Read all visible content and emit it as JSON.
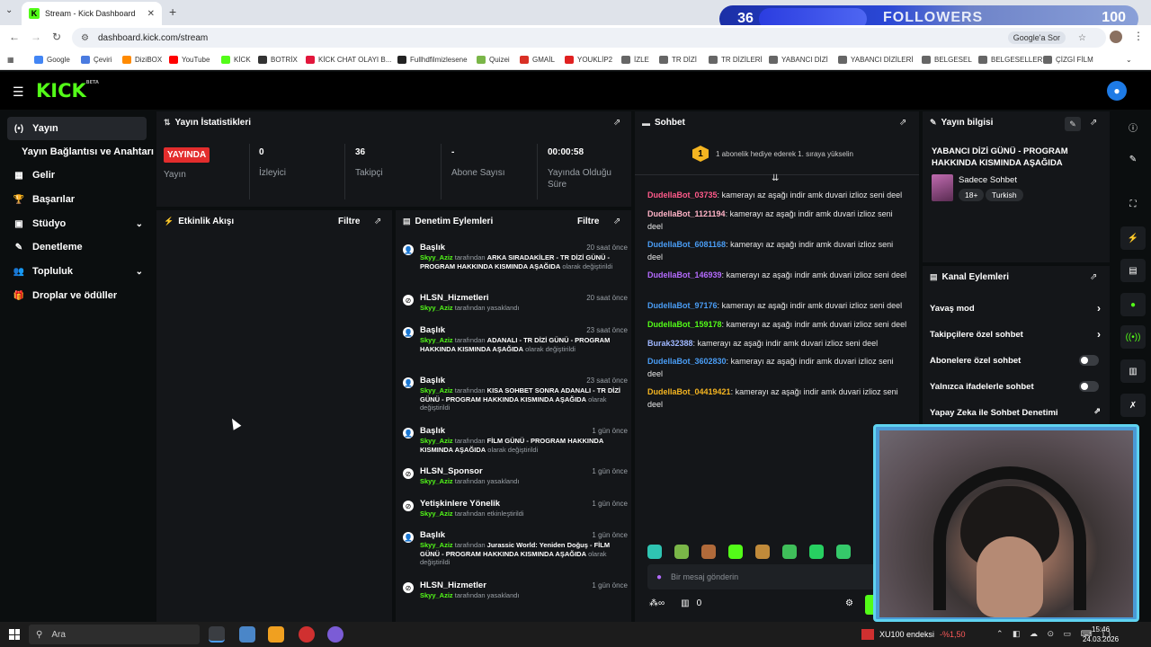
{
  "browser": {
    "tab_title": "Stream - Kick Dashboard",
    "url": "dashboard.kick.com/stream",
    "google_btn": "Google'a Sor",
    "bookmarks": [
      {
        "label": "Google",
        "color": "#4285f4"
      },
      {
        "label": "Çeviri",
        "color": "#4a7be0"
      },
      {
        "label": "DiziBOX",
        "color": "#ff8a00"
      },
      {
        "label": "YouTube",
        "color": "#ff0000"
      },
      {
        "label": "KİCK",
        "color": "#53fc18"
      },
      {
        "label": "BOTRİX",
        "color": "#333333"
      },
      {
        "label": "KİCK CHAT OLAYI B...",
        "color": "#e2163b"
      },
      {
        "label": "Fullhdfilmizlesene",
        "color": "#222222"
      },
      {
        "label": "Quizei",
        "color": "#7ab648"
      },
      {
        "label": "GMAİL",
        "color": "#d93025"
      },
      {
        "label": "YOUKLİP2",
        "color": "#e02020"
      },
      {
        "label": "İZLE",
        "color": "#666666"
      },
      {
        "label": "TR DİZİ",
        "color": "#666666"
      },
      {
        "label": "TR DİZİLERİ",
        "color": "#666666"
      },
      {
        "label": "YABANCI DİZİ",
        "color": "#666666"
      },
      {
        "label": "YABANCI DİZİLERİ",
        "color": "#666666"
      },
      {
        "label": "BELGESEL",
        "color": "#666666"
      },
      {
        "label": "BELGESELLER",
        "color": "#666666"
      },
      {
        "label": "ÇİZGİ FİLM",
        "color": "#666666"
      }
    ]
  },
  "overlay": {
    "left_count": "36",
    "label": "FOLLOWERS",
    "right_count": "100"
  },
  "kick": {
    "logo": "KICK",
    "beta": "BETA"
  },
  "sidebar": {
    "items": [
      {
        "label": "Yayın",
        "icon": "(•)"
      },
      {
        "label": "Yayın Bağlantısı ve Anahtarı",
        "icon": ""
      },
      {
        "label": "Gelir",
        "icon": "▦"
      },
      {
        "label": "Başarılar",
        "icon": "🏆"
      },
      {
        "label": "Stüdyo",
        "icon": "▣"
      },
      {
        "label": "Denetleme",
        "icon": "✎"
      },
      {
        "label": "Topluluk",
        "icon": "👥"
      },
      {
        "label": "Droplar ve ödüller",
        "icon": "🎁"
      }
    ]
  },
  "stats": {
    "title": "Yayın İstatistikleri",
    "live_badge": "YAYINDA",
    "items": [
      {
        "value": "",
        "label": "Yayın"
      },
      {
        "value": "0",
        "label": "İzleyici"
      },
      {
        "value": "36",
        "label": "Takipçi"
      },
      {
        "value": "-",
        "label": "Abone Sayısı"
      },
      {
        "value": "00:00:58",
        "label": "Yayında Olduğu Süre"
      }
    ]
  },
  "activity": {
    "title": "Etkinlik Akışı",
    "filter": "Filtre"
  },
  "moderation": {
    "title": "Denetim Eylemleri",
    "filter": "Filtre",
    "items": [
      {
        "title": "Başlık",
        "time": "20 saat önce",
        "user": "Skyy_Aziz",
        "by": "tarafından",
        "value": "ARKA SIRADAKİLER - TR DİZİ GÜNÜ - PROGRAM HAKKINDA KISMINDA AŞAĞIDA",
        "suffix": "olarak değiştirildi"
      },
      {
        "title": "HLSN_Hizmetleri",
        "time": "20 saat önce",
        "user": "Skyy_Aziz",
        "by": "tarafından yasaklandı",
        "value": "",
        "suffix": ""
      },
      {
        "title": "Başlık",
        "time": "23 saat önce",
        "user": "Skyy_Aziz",
        "by": "tarafından",
        "value": "ADANALI - TR DİZİ GÜNÜ - PROGRAM HAKKINDA KISMINDA AŞAĞIDA",
        "suffix": "olarak değiştirildi"
      },
      {
        "title": "Başlık",
        "time": "23 saat önce",
        "user": "Skyy_Aziz",
        "by": "tarafından",
        "value": "KISA SOHBET SONRA ADANALI - TR DİZİ GÜNÜ - PROGRAM HAKKINDA KISMINDA AŞAĞIDA",
        "suffix": "olarak değiştirildi"
      },
      {
        "title": "Başlık",
        "time": "1 gün önce",
        "user": "Skyy_Aziz",
        "by": "tarafından",
        "value": "FİLM GÜNÜ - PROGRAM HAKKINDA KISMINDA AŞAĞIDA",
        "suffix": "olarak değiştirildi"
      },
      {
        "title": "HLSN_Sponsor",
        "time": "1 gün önce",
        "user": "Skyy_Aziz",
        "by": "tarafından yasaklandı",
        "value": "",
        "suffix": ""
      },
      {
        "title": "Yetişkinlere Yönelik",
        "time": "1 gün önce",
        "user": "Skyy_Aziz",
        "by": "tarafından etkinleştirildi",
        "value": "",
        "suffix": ""
      },
      {
        "title": "Başlık",
        "time": "1 gün önce",
        "user": "Skyy_Aziz",
        "by": "tarafından",
        "value": "Jurassic World: Yeniden Doğuş - FİLM GÜNÜ - PROGRAM HAKKINDA KISMINDA AŞAĞIDA",
        "suffix": "olarak değiştirildi"
      },
      {
        "title": "HLSN_Hizmetler",
        "time": "1 gün önce",
        "user": "Skyy_Aziz",
        "by": "tarafından yasaklandı",
        "value": "",
        "suffix": ""
      }
    ]
  },
  "chat": {
    "title": "Sohbet",
    "gift_banner": "1 abonelik hediye ederek 1. sıraya yükselin",
    "gift_count": "1",
    "messages": [
      {
        "user": "DudellaBot_03735",
        "color": "#ff5a8a",
        "text": "kamerayı az aşağı indir amk duvari izlioz seni deel"
      },
      {
        "user": "DudellaBot_1121194",
        "color": "#ffb3c6",
        "text": "kamerayı az aşağı indir amk duvari izlioz seni deel"
      },
      {
        "user": "DudellaBot_6081168",
        "color": "#4a9df5",
        "text": "kamerayı az aşağı indir amk duvari izlioz seni deel"
      },
      {
        "user": "DudellaBot_146939",
        "color": "#b56bff",
        "text": "kamerayı az aşağı indir amk duvari izlioz seni deel"
      },
      {
        "user": "DudellaBot_97176",
        "color": "#4a9df5",
        "text": "kamerayı az aşağı indir amk duvari izlioz seni deel"
      },
      {
        "user": "DudellaBot_159178",
        "color": "#53fc18",
        "text": "kamerayı az aşağı indir amk duvari izlioz seni deel"
      },
      {
        "user": "Burak32388",
        "color": "#9fb7ff",
        "text": "kamerayı az aşağı indir amk duvari izlioz seni deel"
      },
      {
        "user": "DudellaBot_3602830",
        "color": "#4a9df5",
        "text": "kamerayı az aşağı indir amk duvari izlioz seni deel"
      },
      {
        "user": "DudellaBot_04419421",
        "color": "#f5b521",
        "text": "kamerayı az aşağı indir amk duvari izlioz seni deel"
      }
    ],
    "input_placeholder": "Bir mesaj gönderin",
    "points": "0"
  },
  "stream_info": {
    "title": "Yayın bilgisi",
    "stream_title": "YABANCI DİZİ GÜNÜ - PROGRAM HAKKINDA KISMINDA AŞAĞIDA",
    "category": "Sadece Sohbet",
    "tags": [
      "18+",
      "Turkish"
    ]
  },
  "channel_actions": {
    "title": "Kanal Eylemleri",
    "items": [
      {
        "label": "Yavaş mod",
        "kind": "arrow"
      },
      {
        "label": "Takipçilere özel sohbet",
        "kind": "arrow"
      },
      {
        "label": "Abonelere özel sohbet",
        "kind": "toggle"
      },
      {
        "label": "Yalnızca ifadelerle sohbet",
        "kind": "toggle"
      },
      {
        "label": "Yapay Zeka ile Sohbet Denetimi",
        "kind": "external"
      }
    ]
  },
  "taskbar": {
    "search": "Ara",
    "stock_name": "XU100 endeksi",
    "stock_change": "-%1,50",
    "time": "15:46",
    "date": "24.03.2026"
  }
}
